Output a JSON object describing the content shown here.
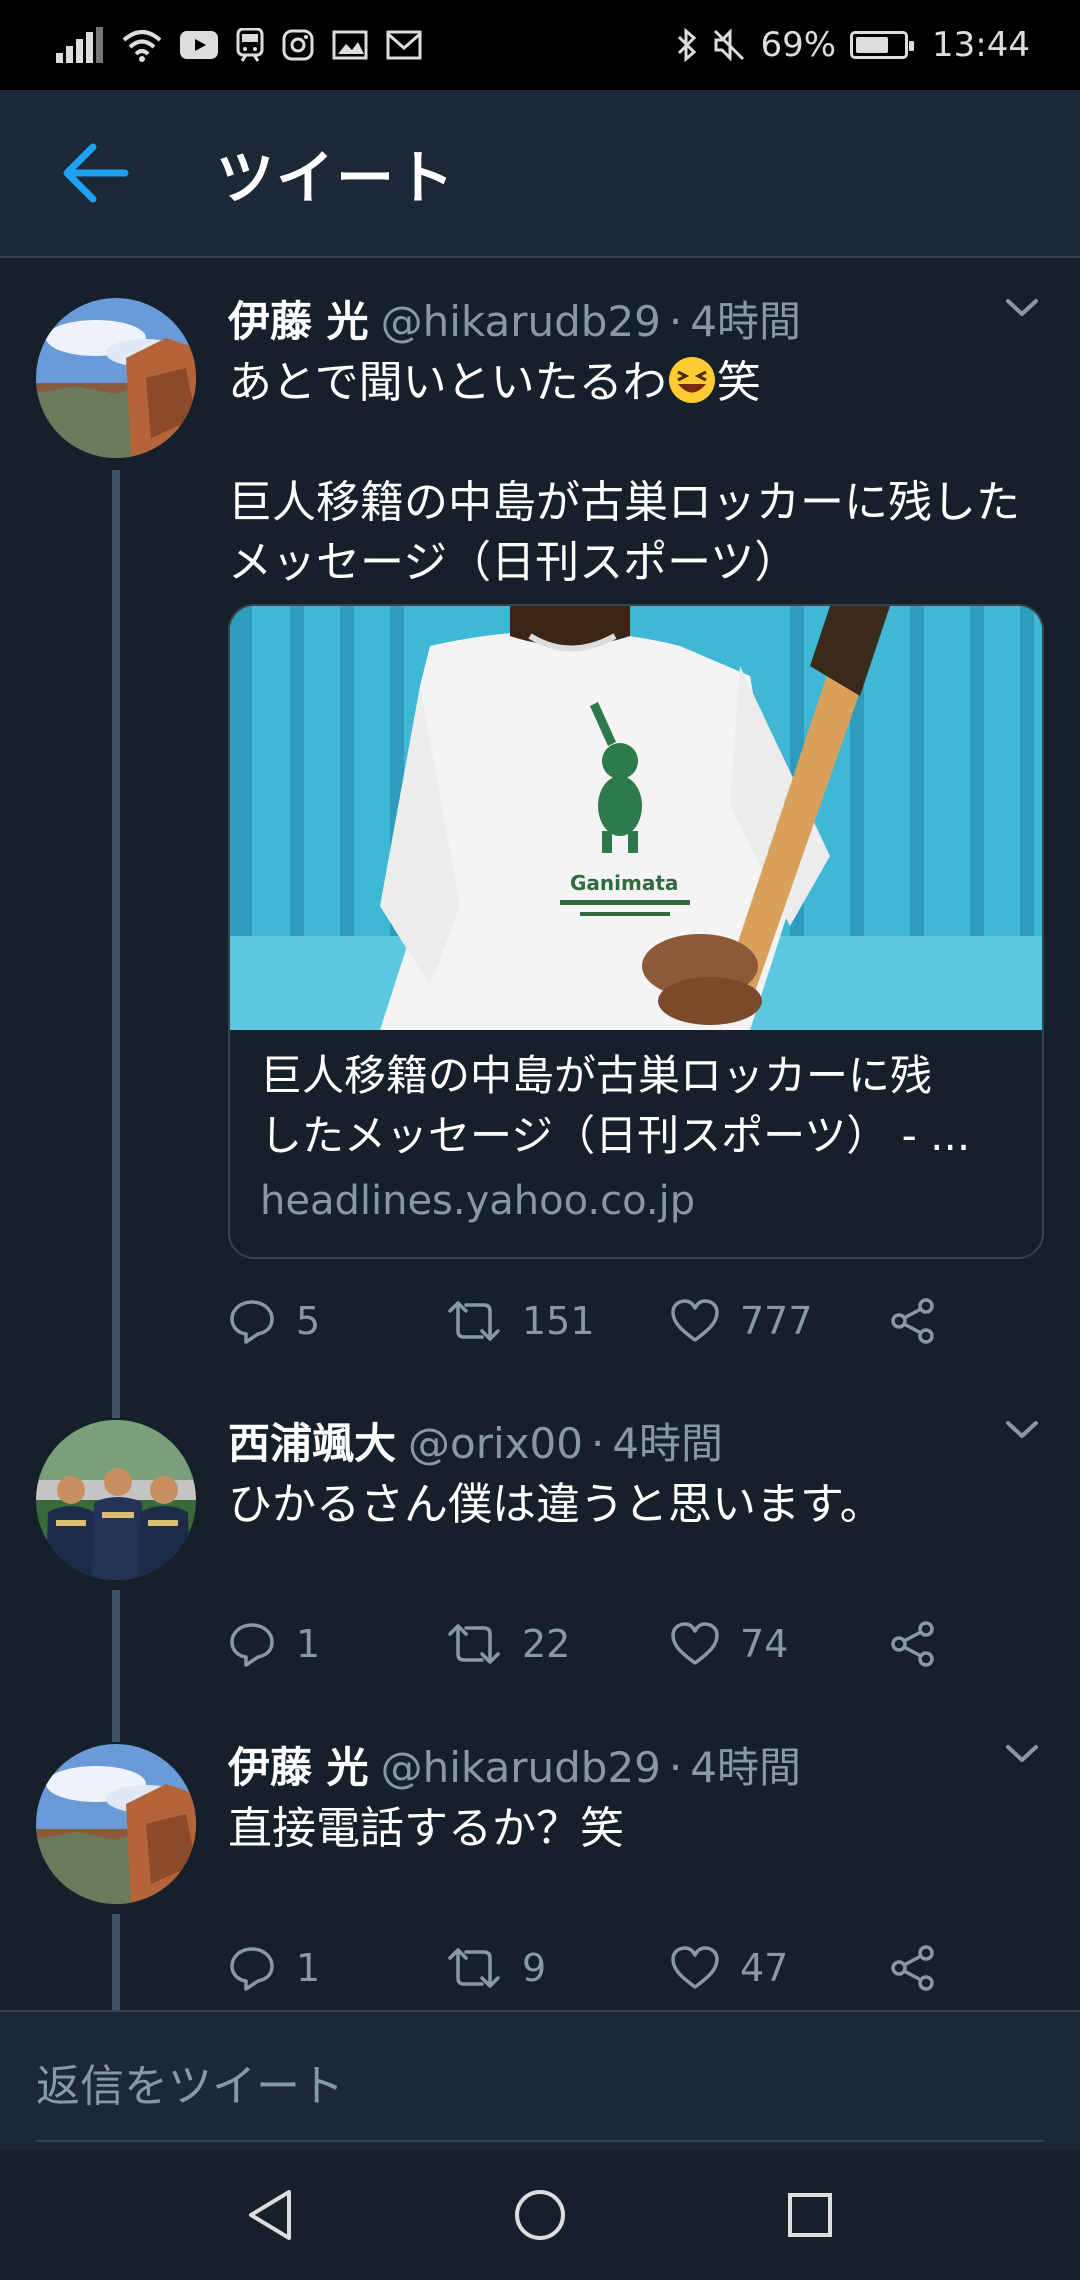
{
  "status_bar": {
    "battery": "69%",
    "battery_level": 0.69,
    "time": "13:44",
    "icons": [
      "signal-icon",
      "wifi-icon",
      "youtube-icon",
      "train-icon",
      "instagram-icon",
      "gallery-icon",
      "mail-icon",
      "bluetooth-icon",
      "mute-icon"
    ]
  },
  "header": {
    "title": "ツイート",
    "back_icon": "arrow-left-icon"
  },
  "colors": {
    "background": "#15202b",
    "header": "#1b2836",
    "accent": "#1da1f2",
    "muted": "#8899a6",
    "thread_line": "#3d5466",
    "border": "#38444d"
  },
  "tweets": [
    {
      "name": "伊藤 光",
      "handle": "@hikarudb29",
      "separator": "·",
      "time": "4時間",
      "text_line1": "あとで聞いといたるわ",
      "text_line1_suffix": "笑",
      "emoji": "laughing-emoji",
      "text_blank": "",
      "text_line3": "巨人移籍の中島が古巣ロッカーに残した",
      "text_line4": "メッセージ（日刊スポーツ）",
      "card": {
        "title_line1": "巨人移籍の中島が古巣ロッカーに残",
        "title_line2": "したメッセージ（日刊スポーツ） - ...",
        "domain": "headlines.yahoo.co.jp",
        "shirt_text": "Ganimata"
      },
      "replies": "5",
      "retweets": "151",
      "likes": "777"
    },
    {
      "name": "西浦颯大",
      "handle": "@orix00",
      "separator": "·",
      "time": "4時間",
      "text": "ひかるさん僕は違うと思います。",
      "replies": "1",
      "retweets": "22",
      "likes": "74"
    },
    {
      "name": "伊藤 光",
      "handle": "@hikarudb29",
      "separator": "·",
      "time": "4時間",
      "text": "直接電話するか？笑",
      "replies": "1",
      "retweets": "9",
      "likes": "47"
    }
  ],
  "reply_bar": {
    "placeholder": "返信をツイート"
  },
  "nav_bar": {
    "icons": [
      "back-triangle-icon",
      "home-circle-icon",
      "recents-square-icon"
    ]
  }
}
